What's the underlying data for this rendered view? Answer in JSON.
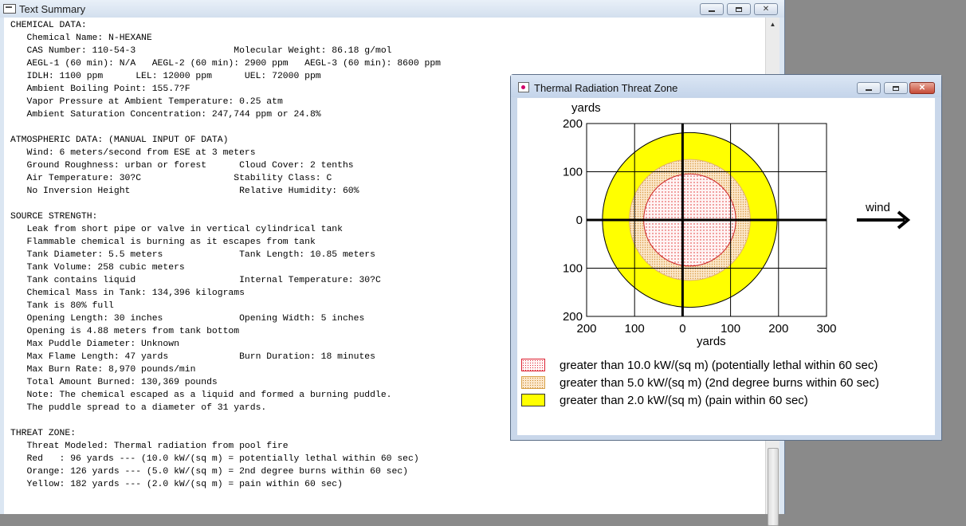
{
  "summary_window": {
    "title": "Text Summary",
    "lines": [
      "CHEMICAL DATA:",
      "   Chemical Name: N-HEXANE",
      "   CAS Number: 110-54-3                  Molecular Weight: 86.18 g/mol",
      "   AEGL-1 (60 min): N/A   AEGL-2 (60 min): 2900 ppm   AEGL-3 (60 min): 8600 ppm",
      "   IDLH: 1100 ppm      LEL: 12000 ppm      UEL: 72000 ppm",
      "   Ambient Boiling Point: 155.7?F",
      "   Vapor Pressure at Ambient Temperature: 0.25 atm",
      "   Ambient Saturation Concentration: 247,744 ppm or 24.8%",
      "",
      "ATMOSPHERIC DATA: (MANUAL INPUT OF DATA)",
      "   Wind: 6 meters/second from ESE at 3 meters",
      "   Ground Roughness: urban or forest      Cloud Cover: 2 tenths",
      "   Air Temperature: 30?C                 Stability Class: C",
      "   No Inversion Height                    Relative Humidity: 60%",
      "",
      "SOURCE STRENGTH:",
      "   Leak from short pipe or valve in vertical cylindrical tank",
      "   Flammable chemical is burning as it escapes from tank",
      "   Tank Diameter: 5.5 meters              Tank Length: 10.85 meters",
      "   Tank Volume: 258 cubic meters",
      "   Tank contains liquid                   Internal Temperature: 30?C",
      "   Chemical Mass in Tank: 134,396 kilograms",
      "   Tank is 80% full",
      "   Opening Length: 30 inches              Opening Width: 5 inches",
      "   Opening is 4.88 meters from tank bottom",
      "   Max Puddle Diameter: Unknown",
      "   Max Flame Length: 47 yards             Burn Duration: 18 minutes",
      "   Max Burn Rate: 8,970 pounds/min",
      "   Total Amount Burned: 130,369 pounds",
      "   Note: The chemical escaped as a liquid and formed a burning puddle.",
      "   The puddle spread to a diameter of 31 yards.",
      "",
      "THREAT ZONE:",
      "   Threat Modeled: Thermal radiation from pool fire",
      "   Red   : 96 yards --- (10.0 kW/(sq m) = potentially lethal within 60 sec)",
      "   Orange: 126 yards --- (5.0 kW/(sq m) = 2nd degree burns within 60 sec)",
      "   Yellow: 182 yards --- (2.0 kW/(sq m) = pain within 60 sec)"
    ]
  },
  "threat_window": {
    "title": "Thermal Radiation Threat Zone",
    "wind_label": "wind",
    "legend": [
      {
        "swatch": "red",
        "text": "greater than 10.0 kW/(sq m) (potentially lethal within 60 sec)"
      },
      {
        "swatch": "orange",
        "text": "greater than 5.0 kW/(sq m) (2nd degree burns within 60 sec)"
      },
      {
        "swatch": "yellow",
        "text": "greater than 2.0 kW/(sq m) (pain within 60 sec)"
      }
    ]
  },
  "chart_data": {
    "type": "threat-zone-map",
    "xlabel": "yards",
    "ylabel": "yards",
    "x_ticks": [
      "200",
      "100",
      "0",
      "100",
      "200",
      "300"
    ],
    "x_tick_values": [
      -200,
      -100,
      0,
      100,
      200,
      300
    ],
    "y_ticks": [
      "200",
      "100",
      "0",
      "100",
      "200"
    ],
    "y_tick_values": [
      200,
      100,
      0,
      -100,
      -200
    ],
    "xlim": [
      -200,
      300
    ],
    "ylim": [
      -200,
      200
    ],
    "grid": true,
    "zones": [
      {
        "name": "Yellow",
        "radius_yards": 182,
        "center": [
          15,
          0
        ],
        "color": "#ffff00"
      },
      {
        "name": "Orange",
        "radius_yards": 126,
        "center": [
          15,
          0
        ],
        "color": "#fbe6c9"
      },
      {
        "name": "Red",
        "radius_yards": 96,
        "center": [
          15,
          0
        ],
        "color": "#fff4f4"
      }
    ]
  }
}
